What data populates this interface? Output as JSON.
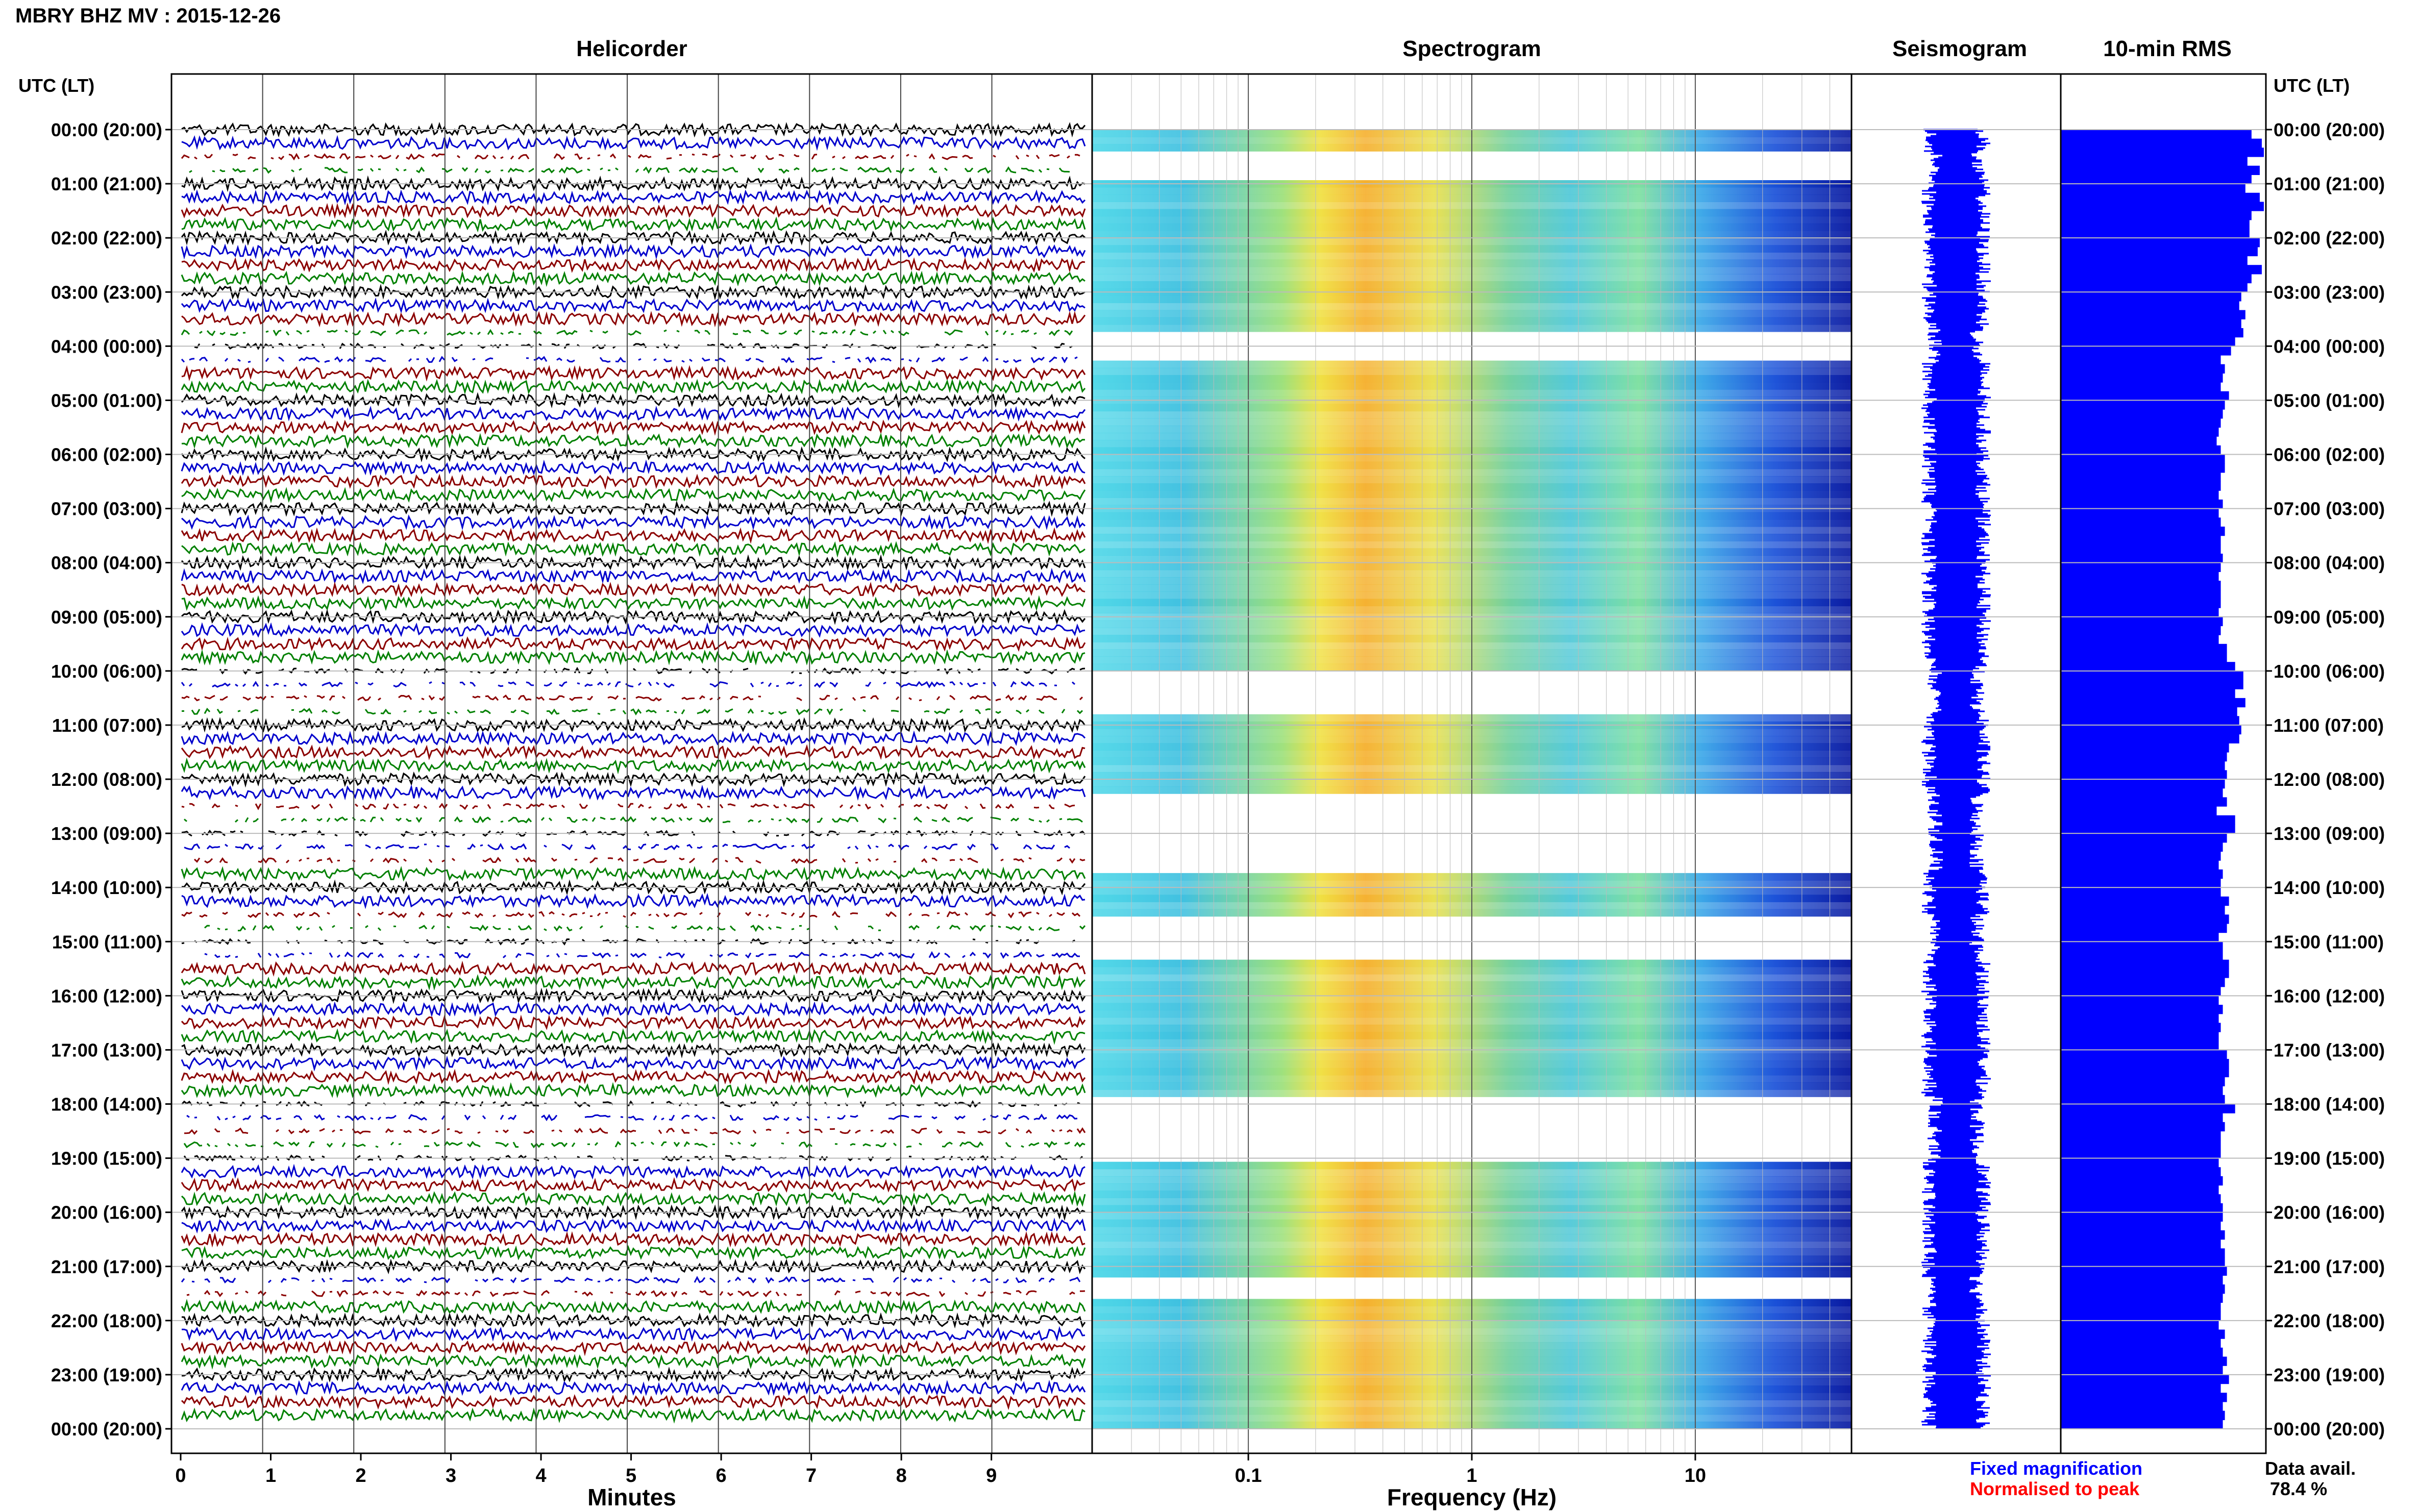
{
  "header": {
    "title": "MBRY BHZ MV : 2015-12-26"
  },
  "panels": {
    "helicorder": "Helicorder",
    "spectrogram": "Spectrogram",
    "seismogram": "Seismogram",
    "rms": "10-min RMS"
  },
  "axes": {
    "left_label": "UTC (LT)",
    "right_label": "UTC (LT)",
    "x_helicorder": "Minutes",
    "x_spectrogram": "Frequency (Hz)"
  },
  "legend": {
    "fixed": "Fixed magnification",
    "normalised": "Normalised to peak",
    "fixed_color": "#0000ff",
    "normalised_color": "#ff0000"
  },
  "availability": {
    "label": "Data avail.",
    "value": "78.4 %"
  },
  "colors": {
    "trace_colors": [
      "#000000",
      "#0000cc",
      "#8b0000",
      "#008000"
    ],
    "rms_bar": "#0000ff",
    "seismogram": "#0000ff"
  },
  "chart_data": {
    "type": "heatmap",
    "time_ticks": [
      "00:00 (20:00)",
      "01:00 (21:00)",
      "02:00 (22:00)",
      "03:00 (23:00)",
      "04:00 (00:00)",
      "05:00 (01:00)",
      "06:00 (02:00)",
      "07:00 (03:00)",
      "08:00 (04:00)",
      "09:00 (05:00)",
      "10:00 (06:00)",
      "11:00 (07:00)",
      "12:00 (08:00)",
      "13:00 (09:00)",
      "14:00 (10:00)",
      "15:00 (11:00)",
      "16:00 (12:00)",
      "17:00 (13:00)",
      "18:00 (14:00)",
      "19:00 (15:00)",
      "20:00 (16:00)",
      "21:00 (17:00)",
      "22:00 (18:00)",
      "23:00 (19:00)",
      "00:00 (20:00)"
    ],
    "minutes_ticks": [
      "0",
      "1",
      "2",
      "3",
      "4",
      "5",
      "6",
      "7",
      "8",
      "9"
    ],
    "minutes_range": [
      0,
      10
    ],
    "frequency_ticks": [
      "0.1",
      "1",
      "10"
    ],
    "frequency_range": [
      0.02,
      50
    ],
    "frequency_scale": "log",
    "rms_relative": [
      0.93,
      0.98,
      0.99,
      0.91,
      0.97,
      0.93,
      0.9,
      0.97,
      0.99,
      0.93,
      0.92,
      0.92,
      0.97,
      0.96,
      0.91,
      0.98,
      0.93,
      0.91,
      0.88,
      0.87,
      0.9,
      0.88,
      0.89,
      0.85,
      0.83,
      0.78,
      0.8,
      0.79,
      0.78,
      0.82,
      0.8,
      0.79,
      0.78,
      0.77,
      0.76,
      0.78,
      0.8,
      0.8,
      0.78,
      0.78,
      0.77,
      0.79,
      0.77,
      0.78,
      0.8,
      0.78,
      0.78,
      0.79,
      0.78,
      0.77,
      0.78,
      0.78,
      0.78,
      0.77,
      0.79,
      0.78,
      0.77,
      0.81,
      0.81,
      0.85,
      0.89,
      0.89,
      0.85,
      0.9,
      0.86,
      0.87,
      0.88,
      0.87,
      0.82,
      0.81,
      0.8,
      0.81,
      0.8,
      0.79,
      0.81,
      0.76,
      0.85,
      0.85,
      0.81,
      0.79,
      0.78,
      0.77,
      0.79,
      0.78,
      0.78,
      0.82,
      0.8,
      0.82,
      0.81,
      0.77,
      0.79,
      0.79,
      0.82,
      0.82,
      0.8,
      0.78,
      0.77,
      0.79,
      0.77,
      0.78,
      0.77,
      0.77,
      0.81,
      0.82,
      0.82,
      0.8,
      0.79,
      0.8,
      0.85,
      0.79,
      0.8,
      0.78,
      0.78,
      0.78,
      0.77,
      0.78,
      0.79,
      0.77,
      0.78,
      0.79,
      0.79,
      0.78,
      0.8,
      0.78,
      0.8,
      0.8,
      0.81,
      0.79,
      0.8,
      0.79,
      0.78,
      0.78,
      0.77,
      0.8,
      0.78,
      0.79,
      0.81,
      0.79,
      0.82,
      0.78,
      0.81,
      0.79,
      0.8,
      0.79
    ],
    "data_gaps_hours": [
      [
        0.4,
        0.9
      ],
      [
        3.7,
        4.3
      ],
      [
        9.95,
        10.8
      ],
      [
        12.3,
        13.7
      ],
      [
        14.5,
        15.3
      ],
      [
        17.9,
        19.0
      ],
      [
        21.2,
        21.6
      ]
    ]
  }
}
